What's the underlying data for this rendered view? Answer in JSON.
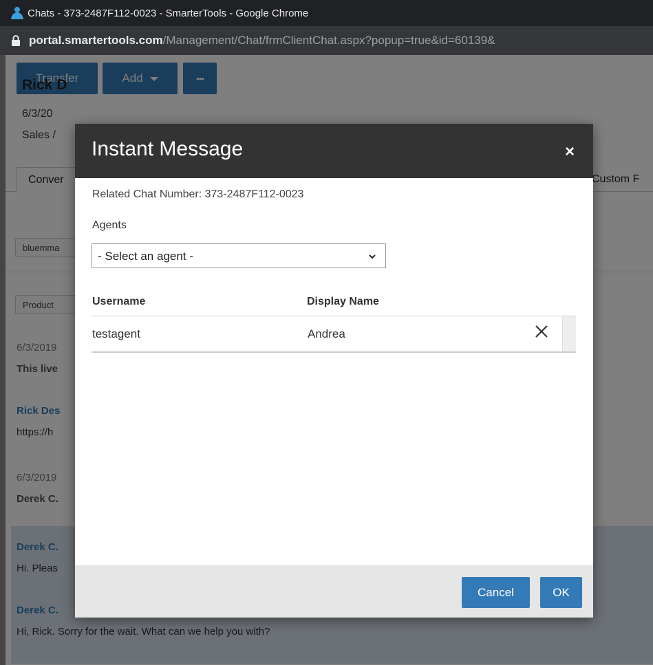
{
  "window": {
    "title": "Chats - 373-2487F112-0023 - SmarterTools - Google Chrome",
    "url_host": "portal.smartertools.com",
    "url_path": "/Management/Chat/frmClientChat.aspx?popup=true&id=60139&"
  },
  "toolbar": {
    "transfer_label": "Transfer",
    "add_label": "Add",
    "more_label": "•••"
  },
  "customer": {
    "name": "Rick D",
    "date": "6/3/20",
    "department": "Sales /"
  },
  "tabs": {
    "conversation": "Conver",
    "custom_fields": "Custom F"
  },
  "chips": {
    "email": "bluemma",
    "product": "Product"
  },
  "messages": [
    {
      "meta": "6/3/2019",
      "text": "This live"
    },
    {
      "author": "Rick Des",
      "text": "https://h"
    },
    {
      "meta": "6/3/2019",
      "text": "Derek C."
    },
    {
      "author": "Derek C.",
      "text": "Hi. Pleas"
    },
    {
      "author": "Derek C.",
      "text": "Hi, Rick. Sorry for the wait. What can we help you with?"
    }
  ],
  "modal": {
    "title": "Instant Message",
    "close_glyph": "×",
    "related_chat": "Related Chat Number: 373-2487F112-0023",
    "agents_label": "Agents",
    "agent_select": {
      "selected": "- Select an agent -"
    },
    "grid": {
      "columns": [
        "Username",
        "Display Name"
      ],
      "rows": [
        {
          "username": "testagent",
          "display_name": "Andrea"
        }
      ]
    },
    "cancel_label": "Cancel",
    "ok_label": "OK"
  },
  "colors": {
    "accent": "#337ab7",
    "modal_header": "#333333",
    "chrome_bar": "#202124"
  }
}
